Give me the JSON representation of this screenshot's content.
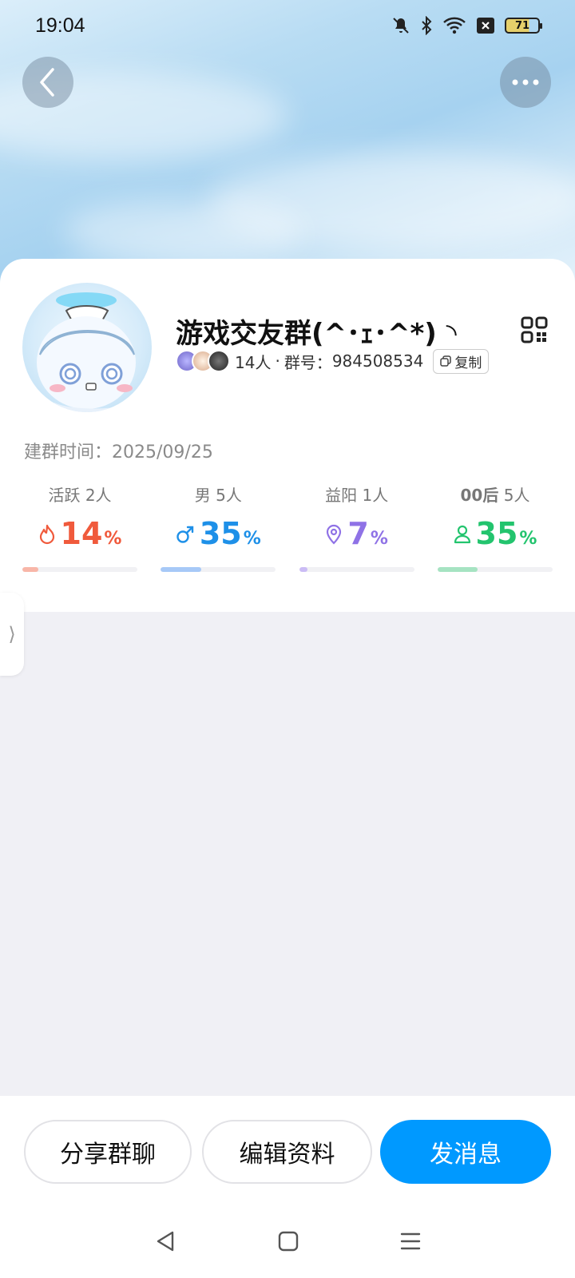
{
  "status_bar": {
    "time": "19:04",
    "battery": "71",
    "icons": [
      "mute-icon",
      "bluetooth-icon",
      "wifi-icon",
      "close-box-icon",
      "battery-icon"
    ]
  },
  "header": {
    "back_icon": "chevron-left-icon",
    "more_icon": "more-dots-icon"
  },
  "group": {
    "name": "游戏交友群(^･ｪ･^*) ◝",
    "member_count": "14人",
    "separator": "·",
    "id_label": "群号：",
    "id": "984508534",
    "copy_label": "复制",
    "created_label": "建群时间：",
    "created_date": "2025/09/25"
  },
  "stats": [
    {
      "key": "active",
      "label": "活跃",
      "count": "2人",
      "value": "14",
      "unit": "%",
      "icon": "flame-icon",
      "color": "#f05a3c",
      "bar_color": "#f8b6a8",
      "fraction": 0.14
    },
    {
      "key": "male",
      "label": "男",
      "count": "5人",
      "value": "35",
      "unit": "%",
      "icon": "male-icon",
      "color": "#1e90e8",
      "bar_color": "#a7c9f7",
      "fraction": 0.35
    },
    {
      "key": "location",
      "label": "益阳",
      "count": "1人",
      "value": "7",
      "unit": "%",
      "icon": "location-pin-icon",
      "color": "#8f72e6",
      "bar_color": "#cbbcf5",
      "fraction": 0.07
    },
    {
      "key": "age",
      "label": "00后",
      "count": "5人",
      "value": "35",
      "unit": "%",
      "icon": "person-icon",
      "color": "#23c46e",
      "bar_color": "#a6e3c2",
      "fraction": 0.35
    }
  ],
  "side_tab": {
    "glyph": "⟩"
  },
  "actions": {
    "share_label": "分享群聊",
    "edit_label": "编辑资料",
    "message_label": "发消息"
  },
  "nav": {
    "back_icon": "nav-back-icon",
    "home_icon": "nav-home-icon",
    "menu_icon": "nav-menu-icon"
  },
  "colors": {
    "primary": "#0099ff",
    "page_bg": "#f0f0f5"
  }
}
